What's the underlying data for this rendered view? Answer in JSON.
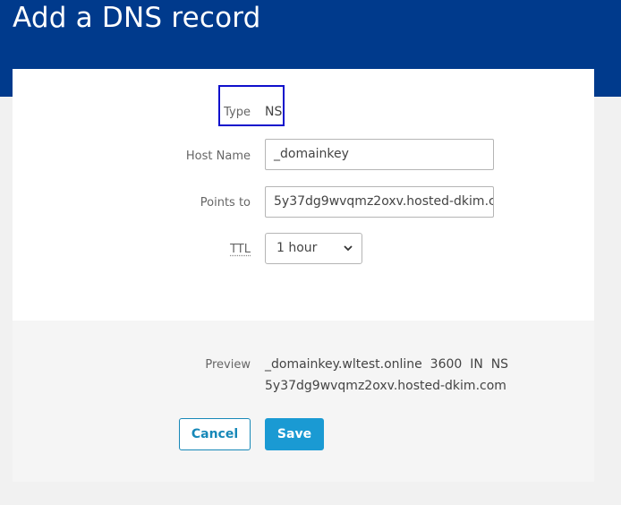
{
  "page": {
    "title": "Add a DNS record"
  },
  "form": {
    "type_label": "Type",
    "type_value": "NS",
    "host_label": "Host Name",
    "host_value": "_domainkey",
    "points_label": "Points to",
    "points_value": "5y37dg9wvqmz2oxv.hosted-dkim.co",
    "ttl_label": "TTL",
    "ttl_value": "1 hour"
  },
  "preview": {
    "label": "Preview",
    "line1": "_domainkey.wltest.online  3600  IN  NS",
    "line2": "5y37dg9wvqmz2oxv.hosted-dkim.com"
  },
  "buttons": {
    "cancel": "Cancel",
    "save": "Save"
  },
  "colors": {
    "header": "#003a8c",
    "accent": "#1a9ad3",
    "highlight_box": "#1010cc"
  }
}
